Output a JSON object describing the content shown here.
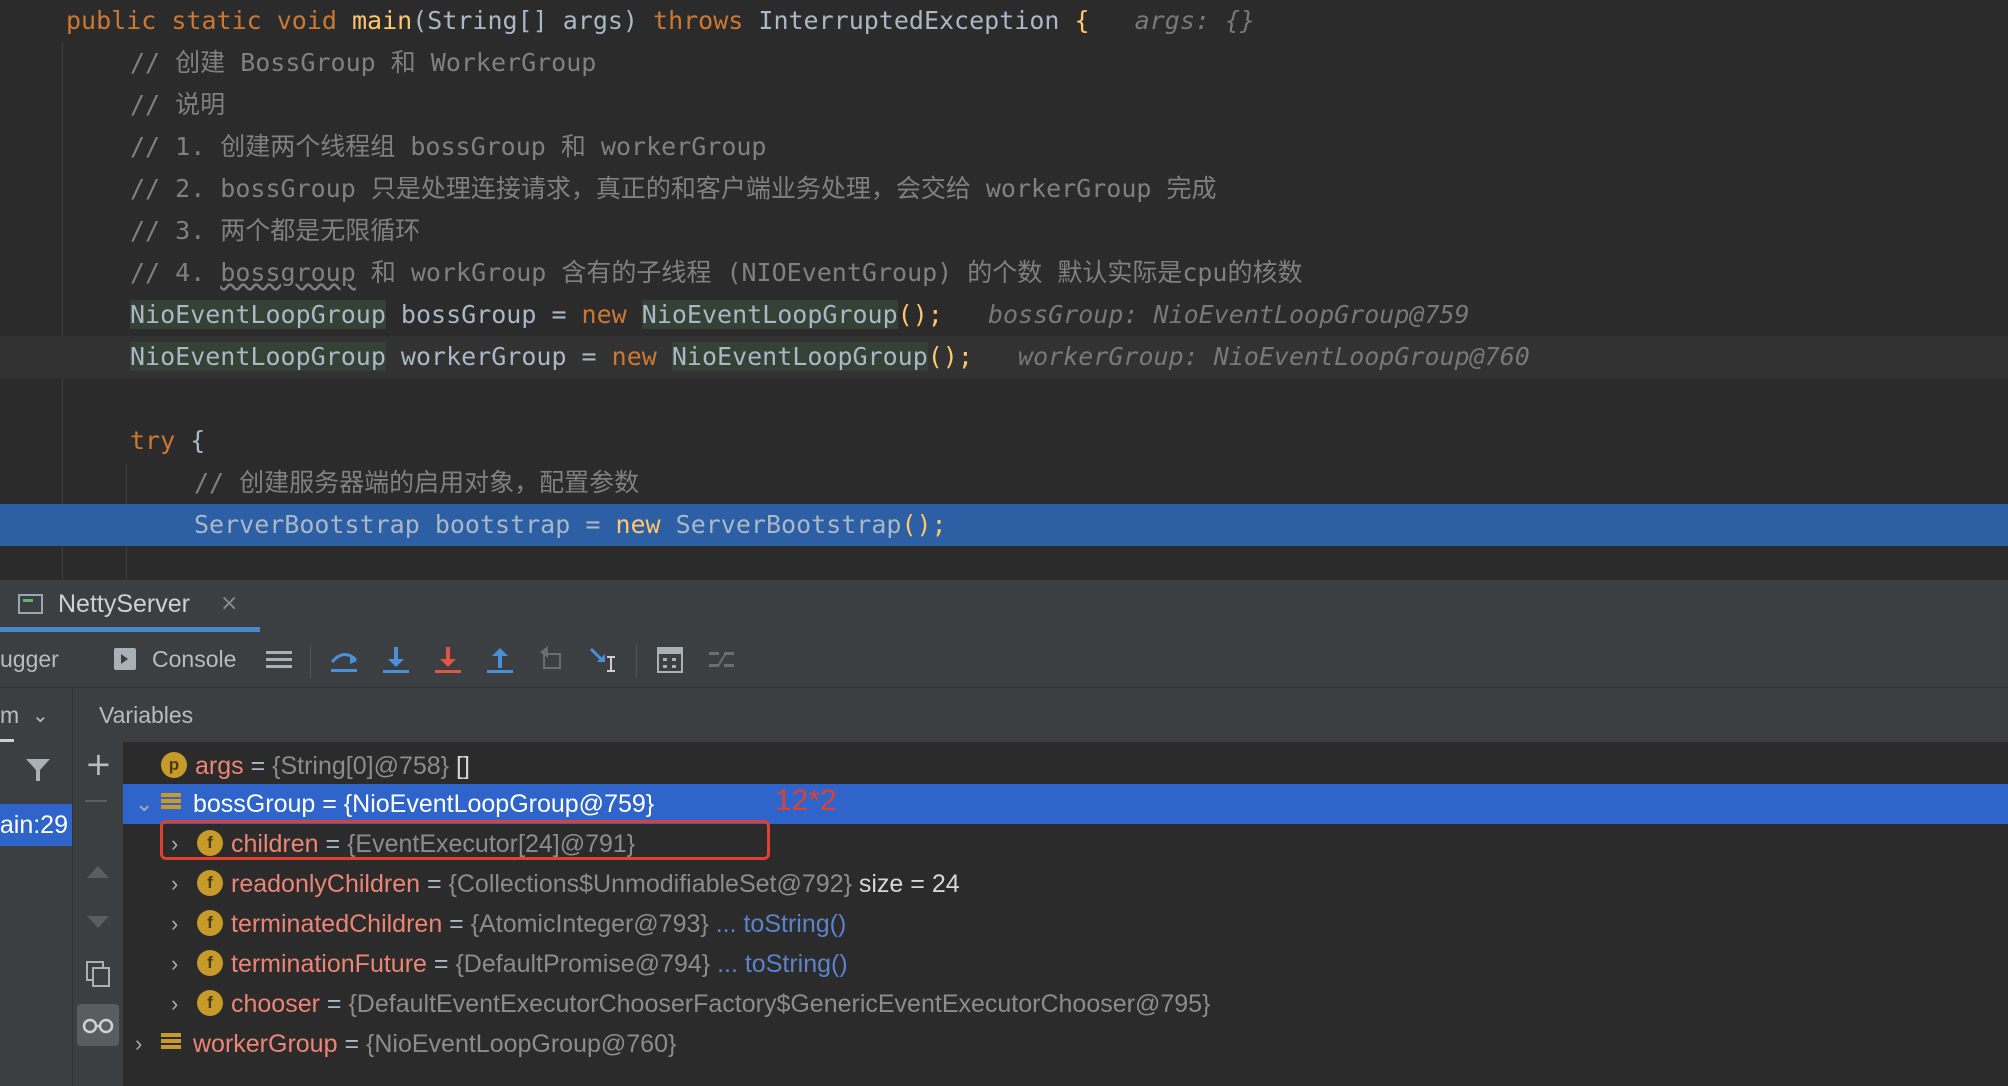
{
  "editor": {
    "lines": [
      {
        "id": "main-signature",
        "indent": 0,
        "segments": [
          {
            "t": "public static void ",
            "c": "kw"
          },
          {
            "t": "main",
            "c": "fn"
          },
          {
            "t": "(String[] args) ",
            "c": ""
          },
          {
            "t": "throws ",
            "c": "kw"
          },
          {
            "t": "InterruptedException ",
            "c": ""
          },
          {
            "t": "{",
            "c": "brc"
          },
          {
            "t": "   args: {}",
            "c": "hint"
          }
        ]
      },
      {
        "id": "comment-1",
        "indent": 1,
        "segments": [
          {
            "t": "// 创建 BossGroup 和 WorkerGroup",
            "c": "cm"
          }
        ]
      },
      {
        "id": "comment-2",
        "indent": 1,
        "segments": [
          {
            "t": "// 说明",
            "c": "cm"
          }
        ]
      },
      {
        "id": "comment-3",
        "indent": 1,
        "segments": [
          {
            "t": "// 1. 创建两个线程组 bossGroup 和 workerGroup",
            "c": "cm"
          }
        ]
      },
      {
        "id": "comment-4",
        "indent": 1,
        "segments": [
          {
            "t": "// 2. bossGroup 只是处理连接请求，真正的和客户端业务处理，会交给 workerGroup 完成",
            "c": "cm"
          }
        ]
      },
      {
        "id": "comment-5",
        "indent": 1,
        "segments": [
          {
            "t": "// 3. 两个都是无限循环",
            "c": "cm"
          }
        ]
      },
      {
        "id": "comment-6",
        "indent": 1,
        "segments": [
          {
            "t": "// 4. ",
            "c": "cm"
          },
          {
            "t": "bossgroup",
            "c": "cm sq"
          },
          {
            "t": " 和 workGroup 含有的子线程 (NIOEventGroup) 的个数 默认实际是cpu的核数",
            "c": "cm"
          }
        ]
      },
      {
        "id": "boss-decl",
        "indent": 1,
        "segments": [
          {
            "t": "NioEventLoopGroup",
            "c": "tp"
          },
          {
            "t": " bossGroup = ",
            "c": ""
          },
          {
            "t": "new ",
            "c": "kw"
          },
          {
            "t": "NioEventLoopGroup",
            "c": "tp"
          },
          {
            "t": "();",
            "c": "brc"
          },
          {
            "t": "   bossGroup: NioEventLoopGroup@759",
            "c": "hint"
          }
        ]
      },
      {
        "id": "worker-decl",
        "indent": 1,
        "cur": true,
        "segments": [
          {
            "t": "NioEventLoopGroup",
            "c": "tp"
          },
          {
            "t": " workerGroup = ",
            "c": ""
          },
          {
            "t": "new ",
            "c": "kw"
          },
          {
            "t": "NioEventLoopGroup",
            "c": "tp"
          },
          {
            "t": "();",
            "c": "brc"
          },
          {
            "t": "   workerGroup: NioEventLoopGroup@760",
            "c": "hint"
          }
        ]
      },
      {
        "id": "blank-line",
        "indent": 1,
        "segments": [
          {
            "t": "",
            "c": ""
          }
        ]
      },
      {
        "id": "try-line",
        "indent": 1,
        "segments": [
          {
            "t": "try ",
            "c": "kw"
          },
          {
            "t": "{",
            "c": ""
          }
        ]
      },
      {
        "id": "comment-7",
        "indent": 2,
        "segments": [
          {
            "t": "// 创建服务器端的启用对象，配置参数",
            "c": "cm"
          }
        ]
      },
      {
        "id": "bootstrap-line",
        "indent": 2,
        "exec": true,
        "segments": [
          {
            "t": "ServerBootstrap bootstrap = ",
            "c": ""
          },
          {
            "t": "new ",
            "c": "kw"
          },
          {
            "t": "ServerBootstrap",
            "c": ""
          },
          {
            "t": "();",
            "c": "brc"
          }
        ]
      }
    ]
  },
  "debug_panel": {
    "run_tab": "NettyServer",
    "tabs": {
      "debugger": "ugger",
      "console": "Console"
    },
    "frames_label": "m",
    "frame_item": "ain:29",
    "variables_title": "Variables",
    "annotation": "12*2",
    "variables": [
      {
        "id": "var-args",
        "level": 0,
        "chevron": "",
        "icon": "p",
        "name": "args",
        "value": "{String[0]@758}",
        "extra": " []",
        "link": ""
      },
      {
        "id": "var-bossGroup",
        "level": 0,
        "chevron": "⌄",
        "icon": "stack",
        "name": "bossGroup",
        "value": "{NioEventLoopGroup@759}",
        "extra": "",
        "link": "",
        "selected": true
      },
      {
        "id": "var-children",
        "level": 1,
        "chevron": "›",
        "icon": "f",
        "name": "children",
        "value": "{EventExecutor[24]@791}",
        "extra": "",
        "link": "",
        "boxed": true
      },
      {
        "id": "var-readonlyChildren",
        "level": 1,
        "chevron": "›",
        "icon": "f",
        "name": "readonlyChildren",
        "value": "{Collections$UnmodifiableSet@792}",
        "extra": "  size = 24",
        "link": ""
      },
      {
        "id": "var-terminatedChildren",
        "level": 1,
        "chevron": "›",
        "icon": "f",
        "name": "terminatedChildren",
        "value": "{AtomicInteger@793}",
        "extra": "",
        "link": " ... toString()"
      },
      {
        "id": "var-terminationFuture",
        "level": 1,
        "chevron": "›",
        "icon": "f",
        "name": "terminationFuture",
        "value": "{DefaultPromise@794}",
        "extra": "",
        "link": " ... toString()"
      },
      {
        "id": "var-chooser",
        "level": 1,
        "chevron": "›",
        "icon": "f",
        "name": "chooser",
        "value": "{DefaultEventExecutorChooserFactory$GenericEventExecutorChooser@795}",
        "extra": "",
        "link": ""
      },
      {
        "id": "var-workerGroup",
        "level": 0,
        "chevron": "›",
        "icon": "stack",
        "name": "workerGroup",
        "value": "{NioEventLoopGroup@760}",
        "extra": "",
        "link": ""
      }
    ],
    "colors": {
      "selection": "#2f65ca",
      "annotation": "#e0402f",
      "execution_line": "#2d5fa5"
    }
  }
}
